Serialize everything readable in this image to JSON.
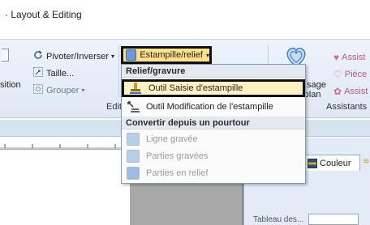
{
  "window": {
    "title": "· Layout & Editing"
  },
  "ribbon": {
    "left_fragment_1": "sition",
    "pivoter_label": "Pivoter/Inverser",
    "taille_label": "Taille...",
    "grouper_label": "Grouper",
    "edit_group_label": "Edit",
    "estampille_label": "Estampille/relief",
    "sage_fragment": "sage",
    "plan_fragment": "-plan",
    "assist_1": "Assist",
    "piece_label": "Pièce",
    "assist_2": "Assist",
    "assistants_group_label": "Assistants"
  },
  "dropdown": {
    "header_relief": "Relief/gravure",
    "item_saisie": "Outil Saisie d'estampille",
    "item_modification": "Outil Modification de l'estampille",
    "header_convertir": "Convertir depuis un pourtour",
    "item_ligne": "Ligne gravée",
    "item_parties_gravees": "Parties gravées",
    "item_parties_relief": "Parties en relief"
  },
  "panel": {
    "couleur_tab": "Couleur",
    "bottom_label": "Tableau des..."
  },
  "colors": {
    "highlight": "#ffe08a",
    "ribbon_bg": "#dfe8f4",
    "canvas_gray": "#a8a8a8"
  }
}
